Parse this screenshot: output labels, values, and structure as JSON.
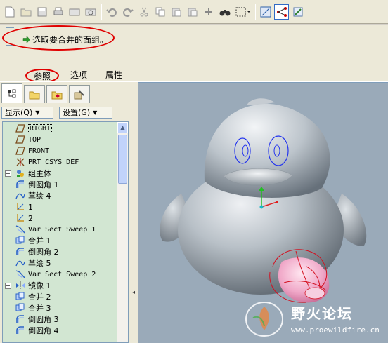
{
  "dashboard": {
    "message": "选取要合并的面组。",
    "tabs": [
      "参照",
      "选项",
      "属性"
    ]
  },
  "filters": {
    "show_label": "显示(Q)",
    "settings_label": "设置(G)"
  },
  "tree": [
    {
      "label": "RIGHT",
      "icon": "datum-plane-icon",
      "mono": true,
      "selected": true
    },
    {
      "label": "TOP",
      "icon": "datum-plane-icon",
      "mono": true
    },
    {
      "label": "FRONT",
      "icon": "datum-plane-icon",
      "mono": true
    },
    {
      "label": "PRT_CSYS_DEF",
      "icon": "csys-icon",
      "mono": true
    },
    {
      "label": "组主体",
      "icon": "group-icon",
      "expand": true
    },
    {
      "label": "倒圆角 1",
      "icon": "round-icon"
    },
    {
      "label": "草绘 4",
      "icon": "sketch-icon"
    },
    {
      "label": "1",
      "icon": "datum-curve-icon"
    },
    {
      "label": "2",
      "icon": "datum-curve-icon"
    },
    {
      "label": "Var Sect Sweep 1",
      "icon": "sweep-icon",
      "mono": true
    },
    {
      "label": "合并 1",
      "icon": "merge-icon"
    },
    {
      "label": "倒圆角 2",
      "icon": "round-icon"
    },
    {
      "label": "草绘 5",
      "icon": "sketch-icon"
    },
    {
      "label": "Var Sect Sweep 2",
      "icon": "sweep-icon",
      "mono": true
    },
    {
      "label": "镜像 1",
      "icon": "mirror-icon",
      "expand": true
    },
    {
      "label": "合并 2",
      "icon": "merge-icon"
    },
    {
      "label": "合并 3",
      "icon": "merge-icon"
    },
    {
      "label": "倒圆角 3",
      "icon": "round-icon"
    },
    {
      "label": "倒圆角 4",
      "icon": "round-icon"
    }
  ],
  "watermark": {
    "title": "野火论坛",
    "url": "www.proewildfire.cn"
  },
  "colors": {
    "annotation_red": "#e00000",
    "tree_bg": "#d2e6d2",
    "viewport_bg": "#9aaab9"
  }
}
